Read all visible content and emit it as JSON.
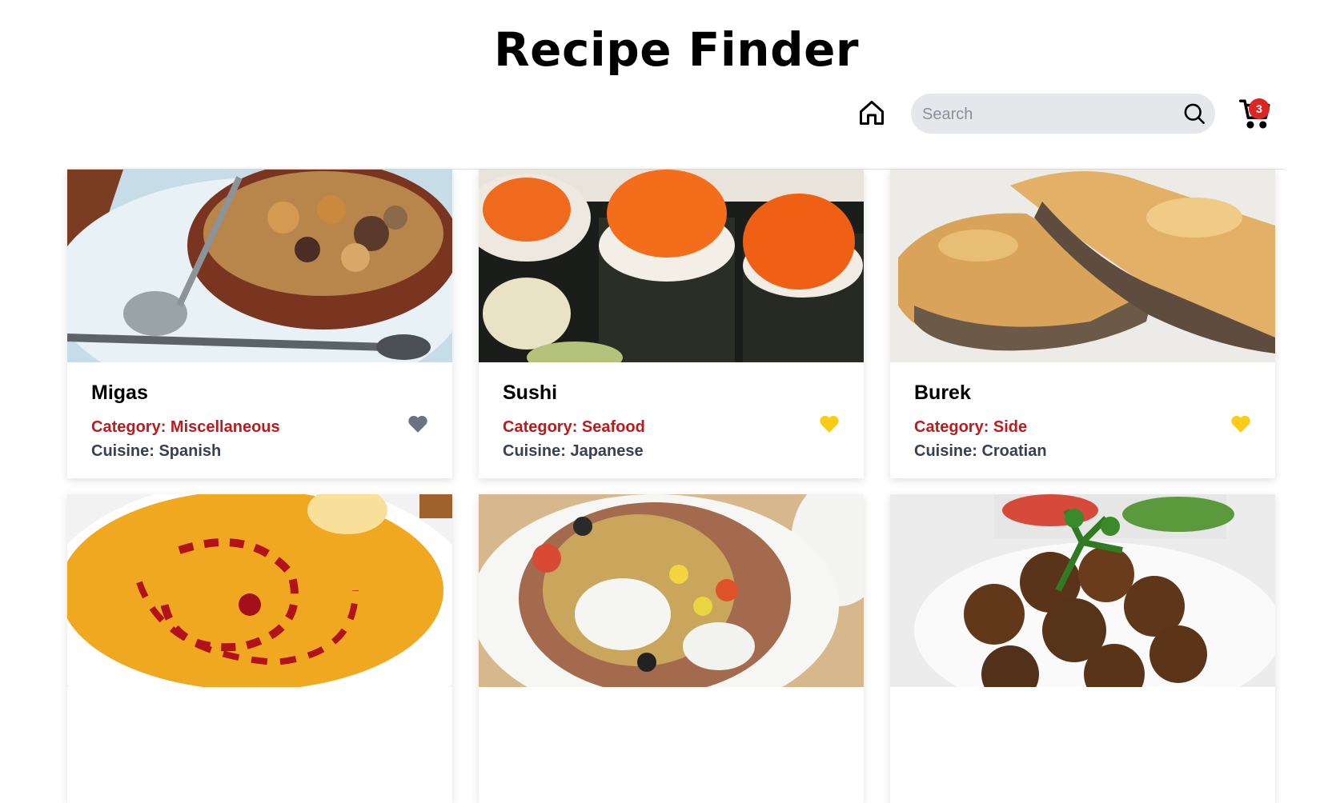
{
  "header": {
    "title": "Recipe Finder"
  },
  "nav": {
    "home_icon": "home-icon",
    "search": {
      "placeholder": "Search",
      "value": "",
      "icon": "search-icon"
    },
    "cart": {
      "icon": "cart-icon",
      "count": "3"
    }
  },
  "colors": {
    "accent_red": "#dc2626",
    "category_red": "#b91c1c",
    "favorite_yellow": "#facc15",
    "unfavorite_gray": "#6b7280",
    "search_bg": "#e5e7eb"
  },
  "recipes": [
    {
      "name": "Migas",
      "category": "Category: Miscellaneous",
      "cuisine": "Cuisine: Spanish",
      "favorite": false
    },
    {
      "name": "Sushi",
      "category": "Category: Seafood",
      "cuisine": "Cuisine: Japanese",
      "favorite": true
    },
    {
      "name": "Burek",
      "category": "Category: Side",
      "cuisine": "Cuisine: Croatian",
      "favorite": true
    },
    {
      "name": "",
      "category": "",
      "cuisine": "",
      "favorite": false
    },
    {
      "name": "",
      "category": "",
      "cuisine": "",
      "favorite": false
    },
    {
      "name": "",
      "category": "",
      "cuisine": "",
      "favorite": false
    }
  ]
}
